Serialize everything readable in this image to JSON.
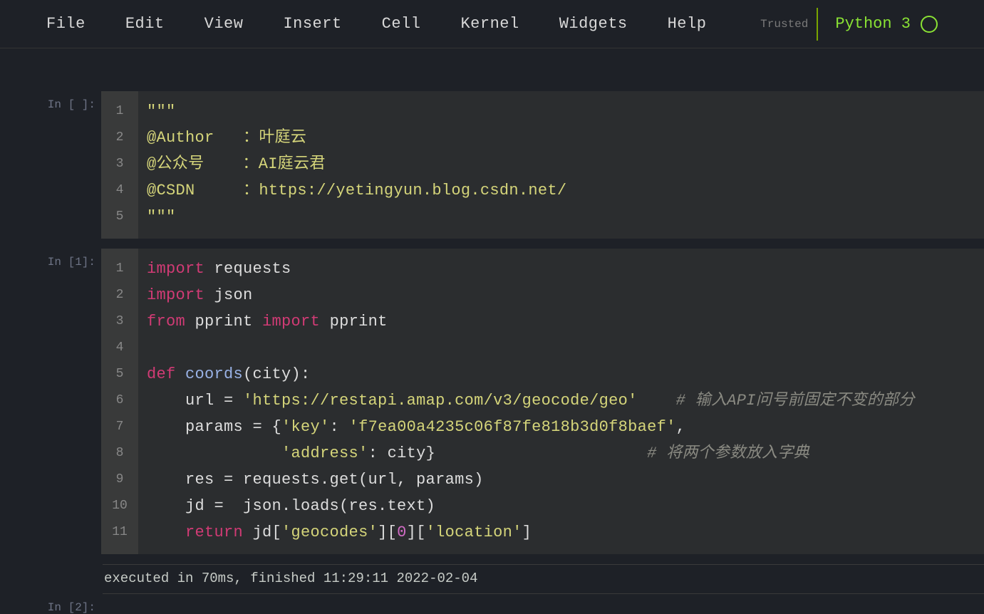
{
  "menubar": {
    "items": [
      "File",
      "Edit",
      "View",
      "Insert",
      "Cell",
      "Kernel",
      "Widgets",
      "Help"
    ],
    "trusted": "Trusted",
    "kernel": "Python 3"
  },
  "cells": [
    {
      "prompt": "In [ ]:",
      "lines": [
        [
          {
            "t": "\"\"\"",
            "c": "str"
          }
        ],
        [
          {
            "t": "@Author   ：叶庭云",
            "c": "str"
          }
        ],
        [
          {
            "t": "@公众号    ：AI庭云君",
            "c": "str"
          }
        ],
        [
          {
            "t": "@CSDN     ：https://yetingyun.blog.csdn.net/",
            "c": "str"
          }
        ],
        [
          {
            "t": "\"\"\"",
            "c": "str"
          }
        ]
      ]
    },
    {
      "prompt": "In [1]:",
      "lines": [
        [
          {
            "t": "import",
            "c": "kw"
          },
          {
            "t": " requests",
            "c": "id"
          }
        ],
        [
          {
            "t": "import",
            "c": "kw"
          },
          {
            "t": " json",
            "c": "id"
          }
        ],
        [
          {
            "t": "from",
            "c": "kw"
          },
          {
            "t": " pprint ",
            "c": "id"
          },
          {
            "t": "import",
            "c": "kw"
          },
          {
            "t": " pprint",
            "c": "id"
          }
        ],
        [],
        [
          {
            "t": "def",
            "c": "kw"
          },
          {
            "t": " ",
            "c": "id"
          },
          {
            "t": "coords",
            "c": "fn"
          },
          {
            "t": "(city):",
            "c": "id"
          }
        ],
        [
          {
            "t": "    url = ",
            "c": "id"
          },
          {
            "t": "'https://restapi.amap.com/v3/geocode/geo'",
            "c": "str"
          },
          {
            "t": "    ",
            "c": "id"
          },
          {
            "t": "# 输入API问号前固定不变的部分",
            "c": "cmt"
          }
        ],
        [
          {
            "t": "    params = {",
            "c": "id"
          },
          {
            "t": "'key'",
            "c": "str"
          },
          {
            "t": ": ",
            "c": "id"
          },
          {
            "t": "'f7ea00a4235c06f87fe818b3d0f8baef'",
            "c": "str"
          },
          {
            "t": ",",
            "c": "id"
          }
        ],
        [
          {
            "t": "              ",
            "c": "id"
          },
          {
            "t": "'address'",
            "c": "str"
          },
          {
            "t": ": city}",
            "c": "id"
          },
          {
            "t": "                      ",
            "c": "id"
          },
          {
            "t": "# 将两个参数放入字典",
            "c": "cmt"
          }
        ],
        [
          {
            "t": "    res = requests.get(url, params)",
            "c": "id"
          }
        ],
        [
          {
            "t": "    jd =  json.loads(res.text)",
            "c": "id"
          }
        ],
        [
          {
            "t": "    ",
            "c": "id"
          },
          {
            "t": "return",
            "c": "kw"
          },
          {
            "t": " jd[",
            "c": "id"
          },
          {
            "t": "'geocodes'",
            "c": "str"
          },
          {
            "t": "][",
            "c": "id"
          },
          {
            "t": "0",
            "c": "num"
          },
          {
            "t": "][",
            "c": "id"
          },
          {
            "t": "'location'",
            "c": "str"
          },
          {
            "t": "]",
            "c": "id"
          }
        ]
      ],
      "exec": "executed in 70ms, finished 11:29:11 2022-02-04"
    },
    {
      "prompt": "In [2]:",
      "lines": []
    }
  ]
}
